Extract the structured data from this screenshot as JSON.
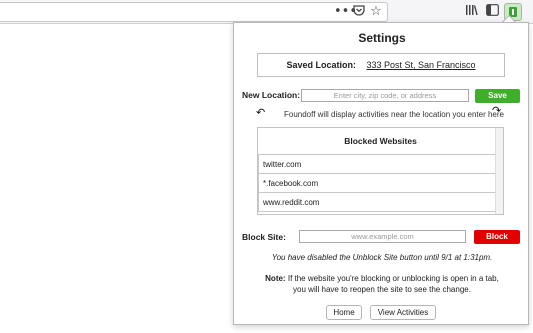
{
  "browser": {
    "icons": [
      "more-actions-icon",
      "pocket-icon",
      "bookmark-star-icon",
      "library-icon",
      "sidebar-icon",
      "extension-icon"
    ]
  },
  "popup": {
    "title": "Settings",
    "saved_location": {
      "label": "Saved Location:",
      "value": "333 Post St, San Francisco"
    },
    "new_location": {
      "label": "New Location:",
      "placeholder": "Enter city, zip code, or address",
      "button": "Save"
    },
    "hint": "Foundoff will display activities near the location you enter here",
    "blocked": {
      "header": "Blocked Websites",
      "items": [
        "twitter.com",
        "*.facebook.com",
        "www.reddit.com"
      ]
    },
    "block_site": {
      "label": "Block Site:",
      "placeholder": "www.example.com",
      "button": "Block"
    },
    "disabled_notice": "You have disabled the Unblock Site button until 9/1 at 1:31pm.",
    "note": {
      "label": "Note:",
      "line1": "If the website you're blocking or unblocking is open in a tab,",
      "line2": "you will have to reopen the site to see the change."
    },
    "footer": {
      "home": "Home",
      "view_activities": "View Activities"
    }
  },
  "colors": {
    "save": "#3fae2a",
    "block": "#e30000"
  }
}
